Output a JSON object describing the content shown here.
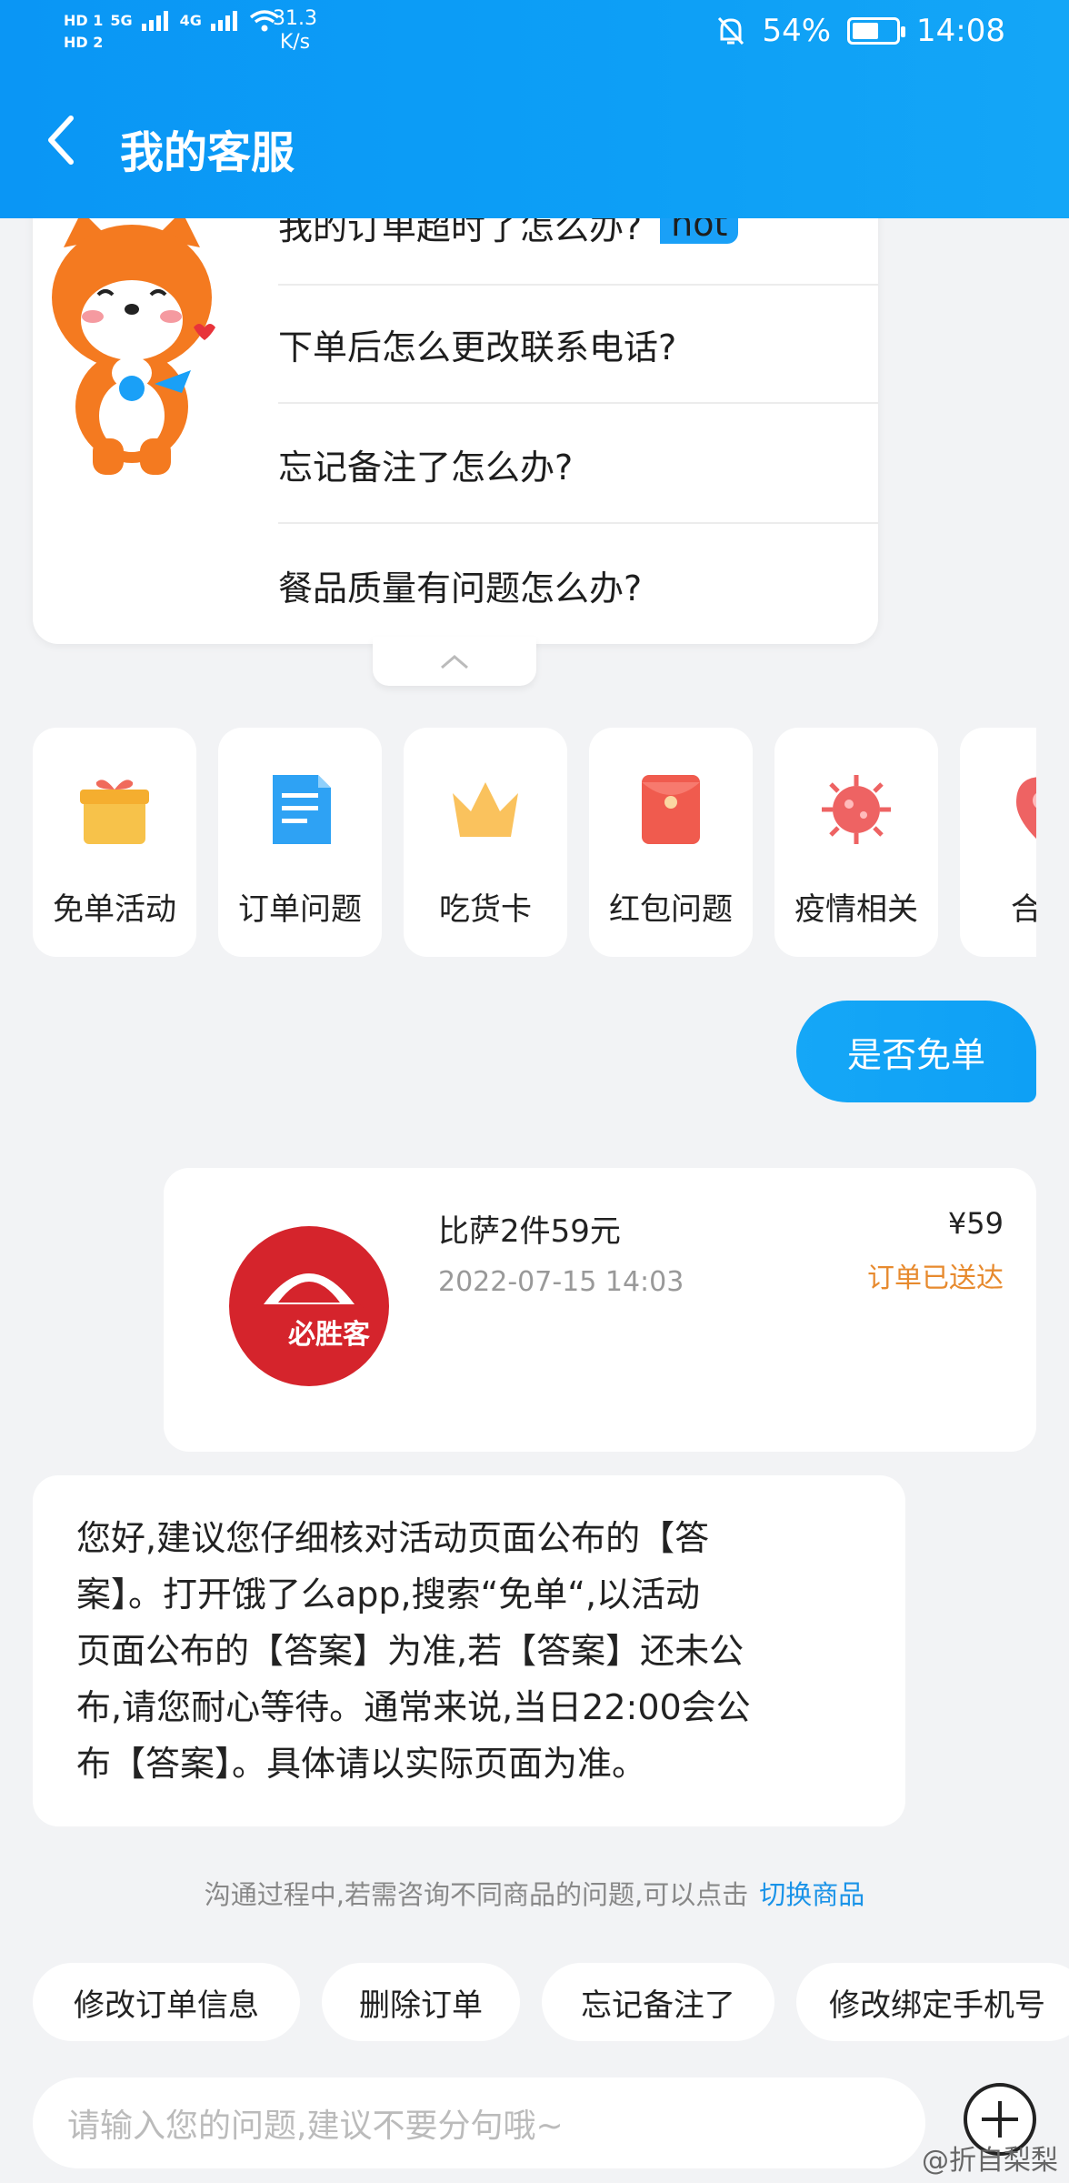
{
  "status_bar": {
    "sim1": "HD 1",
    "sim2": "HD 2",
    "net1": "5G",
    "net2": "4G",
    "speed_value": "31.3",
    "speed_unit": "K/s",
    "battery": "54%",
    "time": "14:08"
  },
  "header": {
    "title": "我的客服"
  },
  "faq": {
    "items": [
      {
        "text": "我的订单超时了怎么办?",
        "badge": "hot"
      },
      {
        "text": "下单后怎么更改联系电话?"
      },
      {
        "text": "忘记备注了怎么办?"
      },
      {
        "text": "餐品质量有问题怎么办?"
      }
    ]
  },
  "categories": [
    {
      "label": "免单活动",
      "icon": "gift-icon",
      "color": "#f7c24a"
    },
    {
      "label": "订单问题",
      "icon": "document-icon",
      "color": "#2ea2f4"
    },
    {
      "label": "吃货卡",
      "icon": "crown-icon",
      "color": "#f9c15c"
    },
    {
      "label": "红包问题",
      "icon": "red-envelope-icon",
      "color": "#f05b4e"
    },
    {
      "label": "疫情相关",
      "icon": "virus-icon",
      "color": "#ee6363"
    },
    {
      "label": "合作",
      "icon": "location-icon",
      "color": "#ee6363"
    }
  ],
  "chat": {
    "user_message": "是否免单",
    "order": {
      "title": "比萨2件59元",
      "date": "2022-07-15 14:03",
      "price": "¥59",
      "status": "订单已送达",
      "logo_text": "必胜客"
    },
    "bot_reply_lines": [
      "您好,建议您仔细核对活动页面公布的【答",
      "案】。打开饿了么app,搜索“免单“,以活动",
      "页面公布的【答案】为准,若【答案】还未公",
      "布,请您耐心等待。通常来说,当日22:00会公",
      "布【答案】。具体请以实际页面为准。"
    ],
    "hint_text": "沟通过程中,若需咨询不同商品的问题,可以点击",
    "hint_link": "切换商品"
  },
  "quick_replies": [
    "修改订单信息",
    "删除订单",
    "忘记备注了",
    "修改绑定手机号"
  ],
  "input": {
    "placeholder": "请输入您的问题,建议不要分句哦~"
  },
  "watermark": "@折自梨梨"
}
